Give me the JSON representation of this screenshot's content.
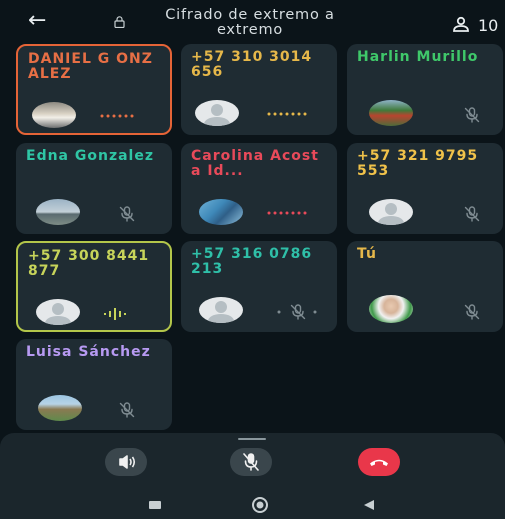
{
  "header": {
    "back_label": "←",
    "title": "Cifrado de extremo a extremo",
    "participant_count": "10"
  },
  "participants": [
    {
      "name": "DANIEL G ONZALEZ",
      "name_color": "#e76f45",
      "status": "connecting",
      "avatar": "photo",
      "highlight": "orange"
    },
    {
      "name": "+57 310 3014656",
      "name_color": "#e6b84a",
      "status": "connecting",
      "avatar": "default"
    },
    {
      "name": "Harlin Murillo",
      "name_color": "#3fc86a",
      "status": "muted",
      "avatar": "photo"
    },
    {
      "name": "Edna Gonzalez",
      "name_color": "#2fc6a5",
      "status": "muted",
      "avatar": "photo"
    },
    {
      "name": "Carolina Acosta Id...",
      "name_color": "#e84a5a",
      "status": "connecting",
      "avatar": "photo"
    },
    {
      "name": "+57 321 9795553",
      "name_color": "#f0c24a",
      "status": "muted",
      "avatar": "default"
    },
    {
      "name": "+57 300 8441877",
      "name_color": "#c7d45a",
      "status": "speaking",
      "avatar": "default",
      "highlight": "yellow"
    },
    {
      "name": "+57 316 0786213",
      "name_color": "#2fbfa8",
      "status": "muted-dim",
      "avatar": "default"
    },
    {
      "name": "Tú",
      "name_color": "#e6b84a",
      "status": "muted",
      "avatar": "photo"
    },
    {
      "name": "Luisa Sánchez",
      "name_color": "#b79af2",
      "status": "muted",
      "avatar": "photo"
    }
  ],
  "controls": {
    "speaker_icon": "speaker-icon",
    "mute_icon": "mic-off-icon",
    "hangup_icon": "phone-hangup-icon"
  },
  "navbar": {
    "recent_icon": "square-icon",
    "home_icon": "circle-icon",
    "back_icon": "triangle-icon"
  }
}
